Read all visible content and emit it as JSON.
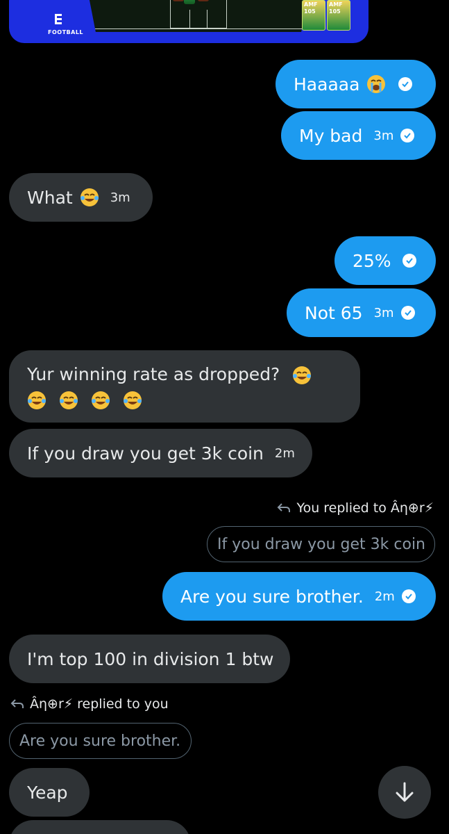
{
  "media": {
    "brand": "FOOTBALL",
    "cards": [
      {
        "pos": "AMF",
        "rating": "105"
      },
      {
        "pos": "AMF",
        "rating": "105"
      }
    ]
  },
  "messages": [
    {
      "id": "m1",
      "side": "sent",
      "text": "Haaaaa",
      "emoji": "loudly-crying-face",
      "time": ""
    },
    {
      "id": "m2",
      "side": "sent",
      "text": "My bad",
      "time": "3m"
    },
    {
      "id": "m3",
      "side": "recv",
      "text": "What",
      "emoji": "tears-of-joy-face",
      "time": "3m"
    },
    {
      "id": "m4",
      "side": "sent",
      "text": "25%",
      "time": ""
    },
    {
      "id": "m5",
      "side": "sent",
      "text": "Not 65",
      "time": "3m"
    },
    {
      "id": "m6",
      "side": "recv",
      "text": "Yur winning rate as dropped?",
      "emoji_count": 5,
      "emoji": "tears-of-joy-face"
    },
    {
      "id": "m7",
      "side": "recv",
      "text": "If you draw you get 3k coin",
      "time": "2m"
    },
    {
      "id": "m8",
      "side": "sent",
      "text": "Are you sure brother.",
      "time": "2m",
      "reply_label": "You replied to Âη⊕r⚡",
      "quoted": "If you draw you get 3k coin"
    },
    {
      "id": "m9",
      "side": "recv",
      "text": "I'm top 100 in division 1 btw"
    },
    {
      "id": "m10",
      "side": "recv",
      "text": "Yeap",
      "reply_label": "Âη⊕r⚡ replied to you",
      "quoted": "Are you sure brother."
    }
  ],
  "colors": {
    "sent_bubble": "#1d9bf0",
    "recv_bubble": "#2f3336",
    "background": "#000000"
  },
  "icons": {
    "read_receipt": "check-circle-icon",
    "reply": "reply-arrow-icon",
    "scroll_down": "arrow-down-icon"
  }
}
